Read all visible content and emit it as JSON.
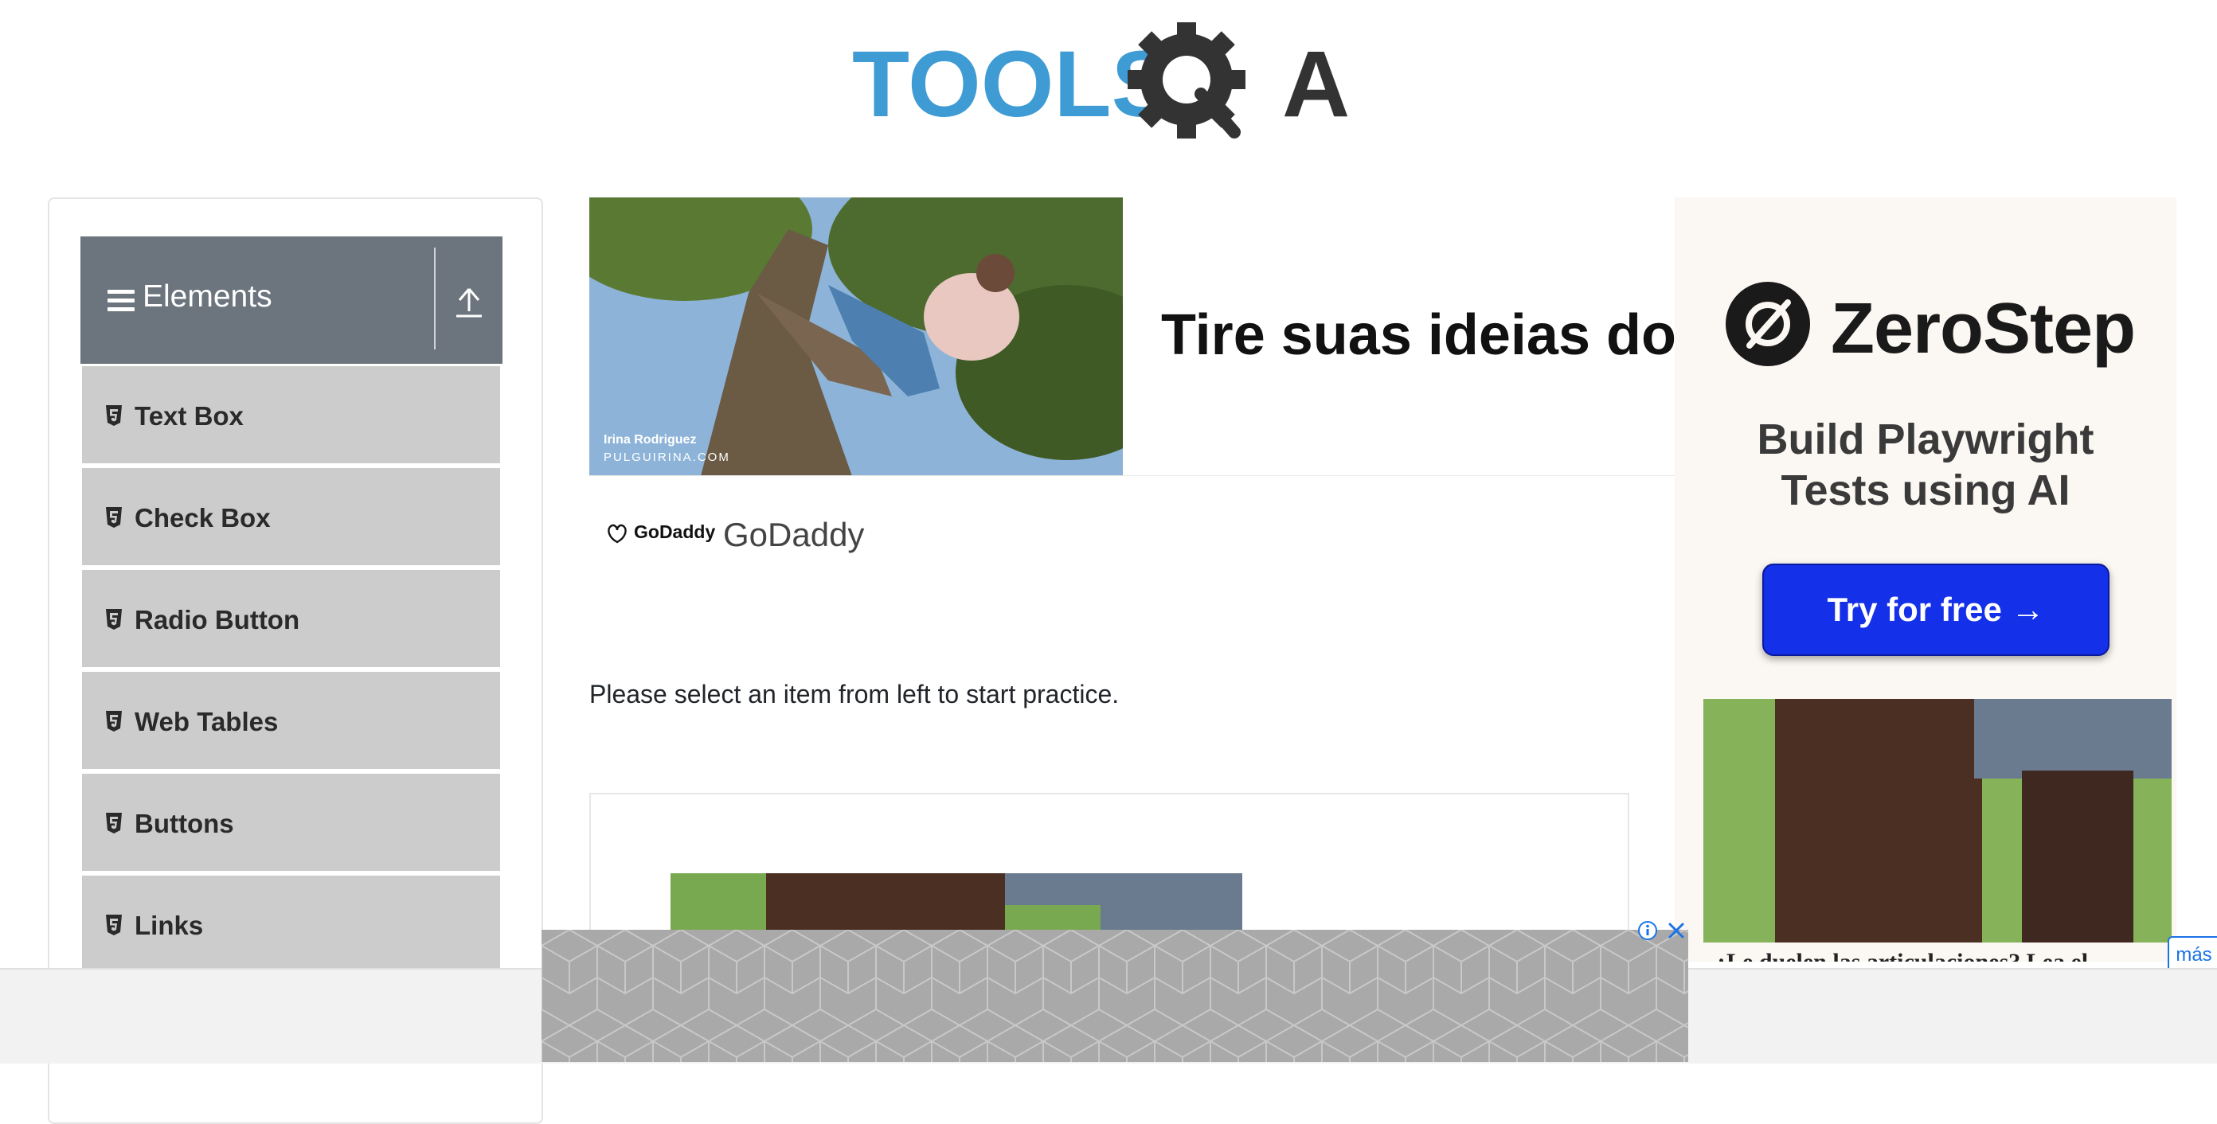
{
  "header": {
    "logo_text_left": "TOOLS",
    "logo_text_right": "A"
  },
  "sidebar": {
    "group_title": "Elements",
    "items": [
      {
        "label": "Text Box"
      },
      {
        "label": "Check Box"
      },
      {
        "label": "Radio Button"
      },
      {
        "label": "Web Tables"
      },
      {
        "label": "Buttons"
      },
      {
        "label": "Links"
      }
    ]
  },
  "main": {
    "ad": {
      "photo_credit_name": "Irina Rodriguez",
      "photo_credit_site": "PULGUIRINA.COM",
      "headline": "Tire suas ideias do p",
      "advertiser_logo": "GoDaddy",
      "advertiser_name": "GoDaddy"
    },
    "intro_text": "Please select an item from left to start practice."
  },
  "right_ad": {
    "brand": "ZeroStep",
    "tagline_line1": "Build Playwright",
    "tagline_line2": "Tests using AI",
    "cta_label": "Try for free →",
    "caption": "¿Le duelen las articulaciones? Lea el",
    "more_label": "más"
  },
  "colors": {
    "group_header_bg": "#6c757d",
    "menu_item_bg": "#cccccc",
    "logo_blue": "#3e9bd4",
    "logo_dark": "#333333",
    "cta_blue": "#1430e8"
  },
  "icons": {
    "hamburger": "menu-icon",
    "collapse": "upload-arrow-icon",
    "item": "html5-icon",
    "ad_info": "info-icon",
    "ad_close": "close-icon"
  }
}
